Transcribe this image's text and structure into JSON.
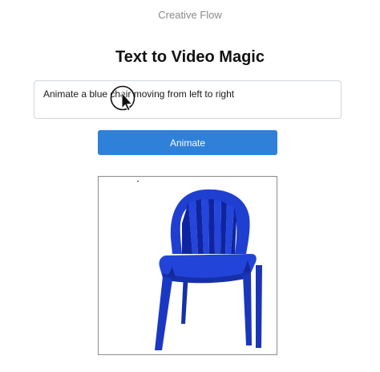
{
  "app": {
    "name": "Creative Flow"
  },
  "page": {
    "title": "Text to Video Magic"
  },
  "prompt": {
    "value": "Animate a blue chair moving from left to right"
  },
  "actions": {
    "animate_label": "Animate"
  },
  "preview": {
    "subject": "blue plastic chair",
    "icon": "blue-chair-image"
  },
  "colors": {
    "accent": "#2f80d8",
    "chair": "#1f3fd1"
  }
}
